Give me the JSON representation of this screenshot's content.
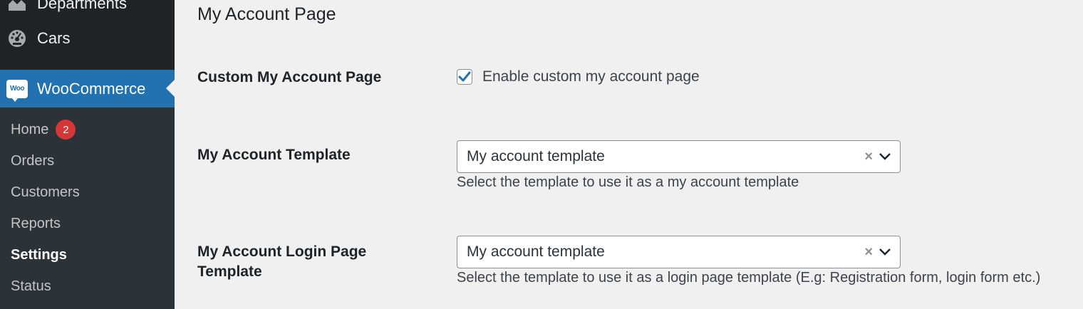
{
  "sidebar": {
    "top_items": [
      {
        "label": "Departments",
        "icon": "departments-icon"
      },
      {
        "label": "Cars",
        "icon": "dashboard-gauge-icon"
      }
    ],
    "active_menu": {
      "label": "WooCommerce",
      "logo_text": "Woo",
      "icon": "woocommerce-icon"
    },
    "submenu": [
      {
        "label": "Home",
        "badge": "2"
      },
      {
        "label": "Orders"
      },
      {
        "label": "Customers"
      },
      {
        "label": "Reports"
      },
      {
        "label": "Settings",
        "current": true
      },
      {
        "label": "Status"
      }
    ]
  },
  "main": {
    "title": "My Account Page",
    "rows": [
      {
        "label": "Custom My Account Page",
        "checkbox_label": "Enable custom my account page",
        "checked": true
      },
      {
        "label": "My Account Template",
        "select_value": "My account template",
        "clear_symbol": "×",
        "description": "Select the template to use it as a my account template"
      },
      {
        "label_line1": "My Account Login Page",
        "label_line2": "Template",
        "select_value": "My account template",
        "clear_symbol": "×",
        "description": "Select the template to use it as a login page template (E.g: Registration form, login form etc.)"
      }
    ]
  },
  "colors": {
    "sidebar_bg": "#1d2327",
    "submenu_bg": "#2c3338",
    "accent": "#2271b1",
    "badge": "#d63638",
    "page_bg": "#f0f0f1"
  }
}
